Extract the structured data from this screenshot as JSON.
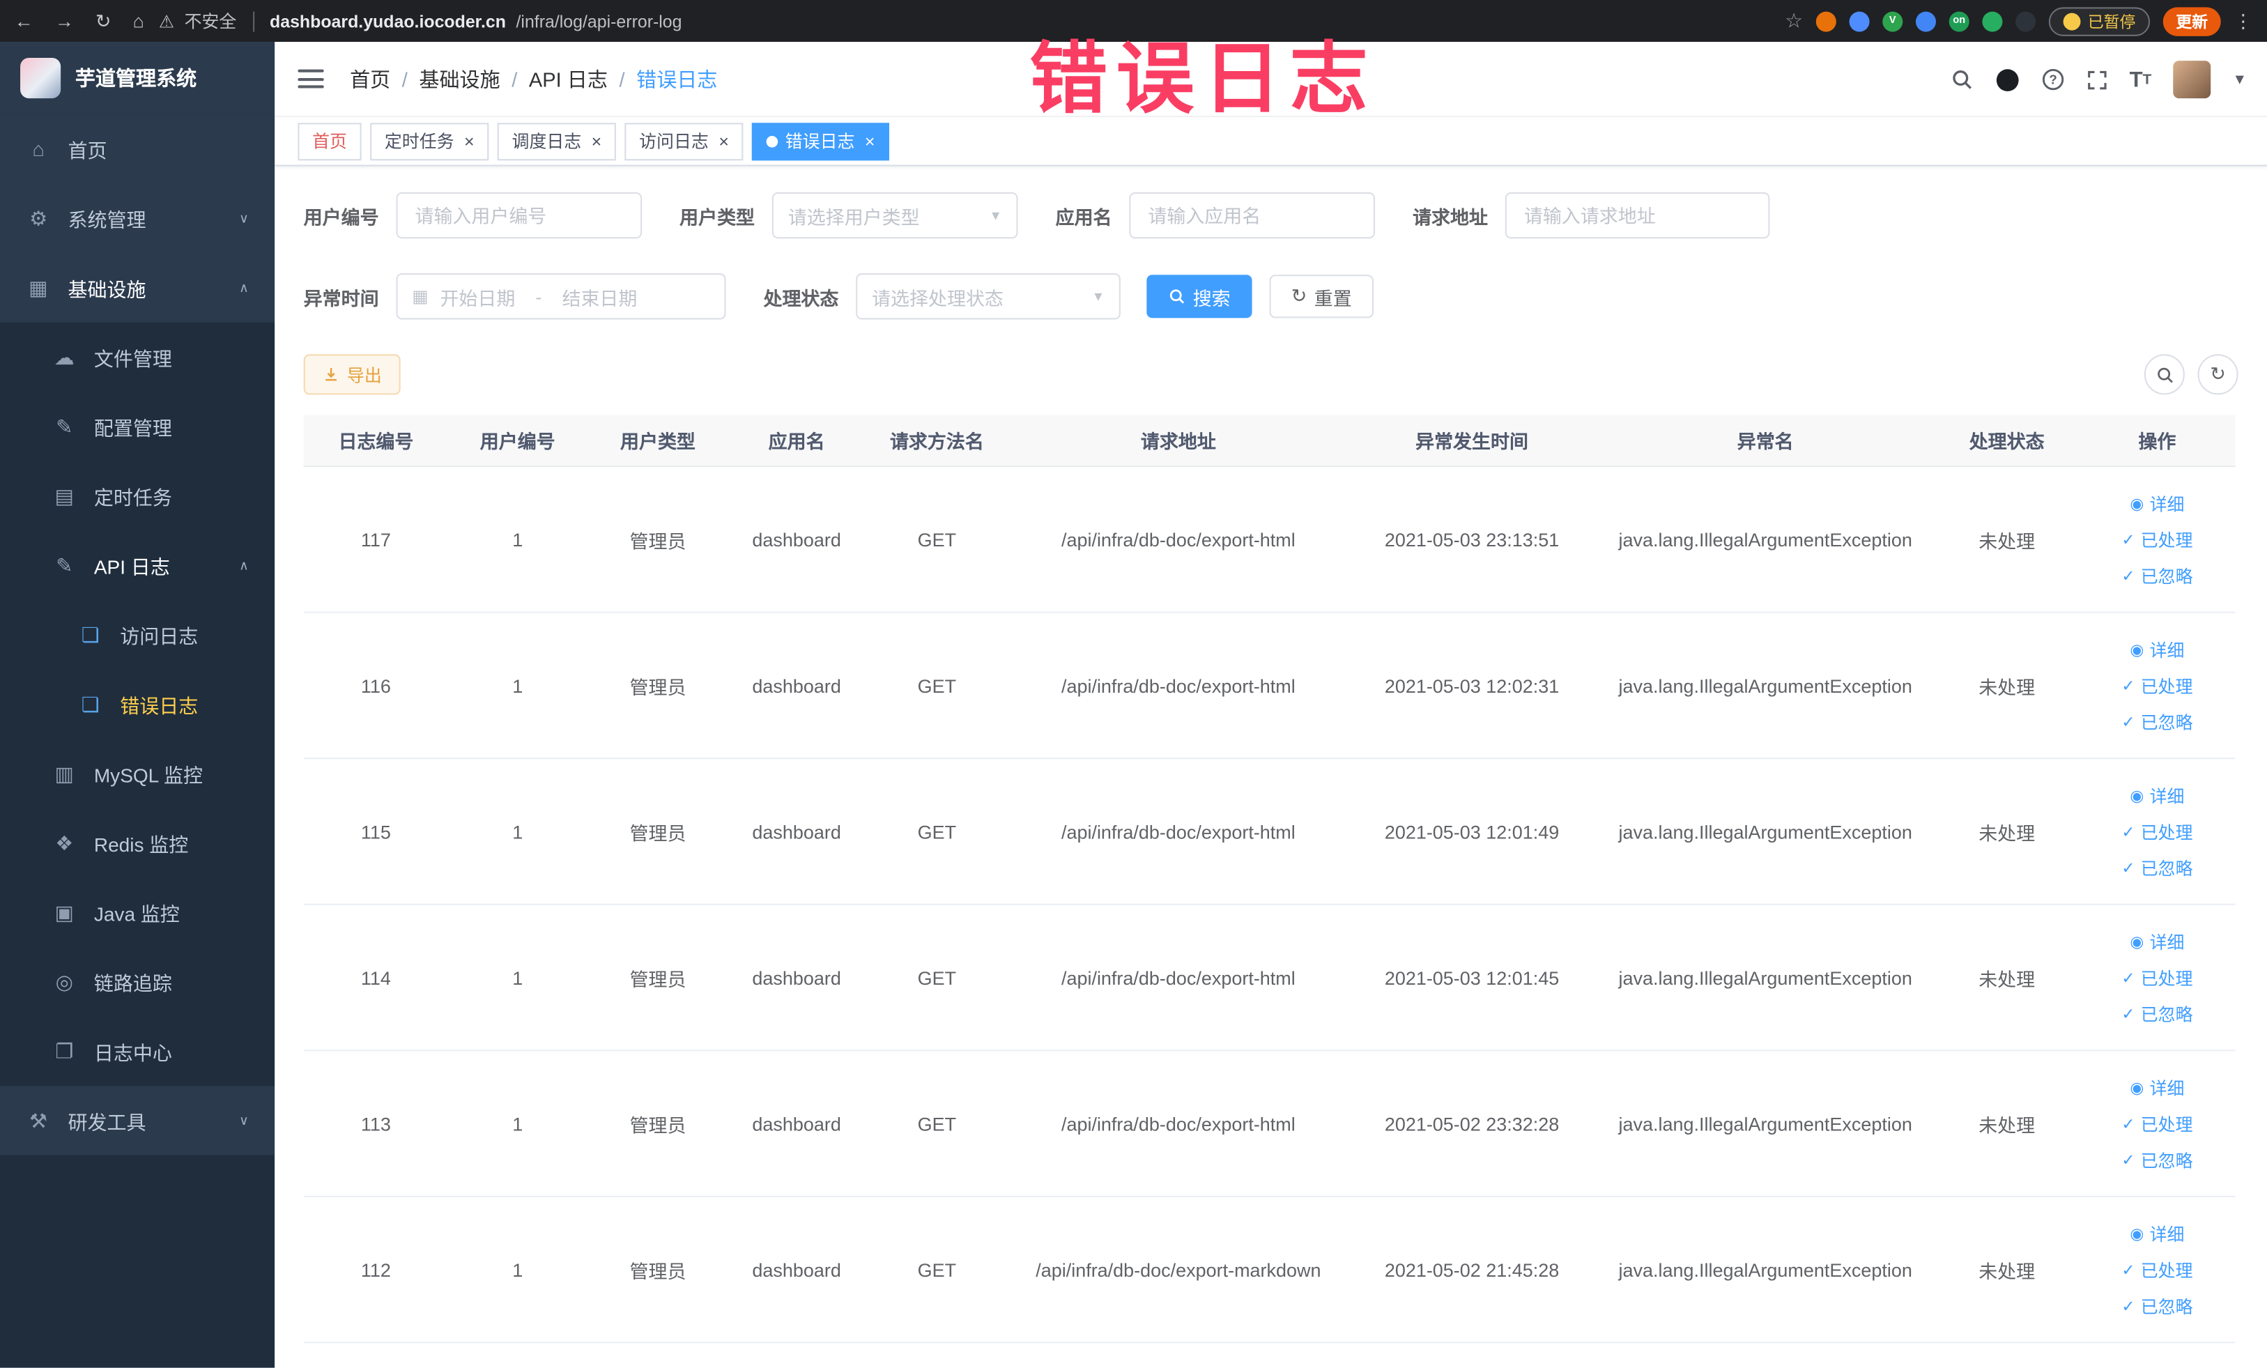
{
  "annotation": {
    "text": "错误日志",
    "color": "#fa3e63"
  },
  "browser": {
    "security_label": "不安全",
    "url_domain": "dashboard.yudao.iocoder.cn",
    "url_path": "/infra/log/api-error-log",
    "paused_badge": "已暂停",
    "update_label": "更新",
    "extensions": [
      {
        "name": "extension-adblock-icon",
        "color": "#e8710a"
      },
      {
        "name": "extension-drop-icon",
        "color": "#4e8cff"
      },
      {
        "name": "extension-vue-devtools-icon",
        "color": "#2ea44f",
        "glyph": "V"
      },
      {
        "name": "extension-grid-icon",
        "color": "#4285f4"
      },
      {
        "name": "extension-switch-on-icon",
        "color": "#1f9d55",
        "glyph": "on"
      },
      {
        "name": "extension-leaf-icon",
        "color": "#27ae60"
      },
      {
        "name": "extension-pawn-icon",
        "color": "#2d333b"
      }
    ]
  },
  "sidebar": {
    "logo_title": "芋道管理系统",
    "items": [
      {
        "id": "home",
        "label": "首页",
        "icon": "home-icon",
        "glyph": "⌂",
        "level": 1
      },
      {
        "id": "system-management",
        "label": "系统管理",
        "icon": "gear-icon",
        "glyph": "⚙",
        "level": 1,
        "chevron": "down"
      },
      {
        "id": "infrastructure",
        "label": "基础设施",
        "icon": "grid-icon",
        "glyph": "▦",
        "level": 1,
        "chevron": "up"
      },
      {
        "id": "file-management",
        "label": "文件管理",
        "icon": "cloud-icon",
        "glyph": "☁",
        "level": 2
      },
      {
        "id": "config-management",
        "label": "配置管理",
        "icon": "edit-icon",
        "glyph": "✎",
        "level": 2
      },
      {
        "id": "scheduled-tasks",
        "label": "定时任务",
        "icon": "schedule-icon",
        "glyph": "▤",
        "level": 2
      },
      {
        "id": "api-logs",
        "label": "API 日志",
        "icon": "log-edit-icon",
        "glyph": "✎",
        "level": 2,
        "chevron": "up"
      },
      {
        "id": "access-log",
        "label": "访问日志",
        "icon": "document-icon",
        "glyph": "❏",
        "level": 3
      },
      {
        "id": "error-log",
        "label": "错误日志",
        "icon": "document-icon",
        "glyph": "❏",
        "level": 3,
        "active": true
      },
      {
        "id": "mysql-monitor",
        "label": "MySQL 监控",
        "icon": "database-icon",
        "glyph": "▥",
        "level": 2
      },
      {
        "id": "redis-monitor",
        "label": "Redis 监控",
        "icon": "layers-icon",
        "glyph": "❖",
        "level": 2
      },
      {
        "id": "java-monitor",
        "label": "Java 监控",
        "icon": "monitor-icon",
        "glyph": "▣",
        "level": 2
      },
      {
        "id": "tracing",
        "label": "链路追踪",
        "icon": "eye-icon",
        "glyph": "◎",
        "level": 2
      },
      {
        "id": "log-center",
        "label": "日志中心",
        "icon": "logs-icon",
        "glyph": "❐",
        "level": 2
      },
      {
        "id": "dev-tools",
        "label": "研发工具",
        "icon": "tools-icon",
        "glyph": "⚒",
        "level": 1,
        "chevron": "down"
      }
    ]
  },
  "header": {
    "breadcrumb": [
      "首页",
      "基础设施",
      "API 日志",
      "错误日志"
    ]
  },
  "tabs": [
    {
      "id": "home",
      "label": "首页",
      "closable": false,
      "text_color": "#e05c5c"
    },
    {
      "id": "scheduled-tasks",
      "label": "定时任务",
      "closable": true
    },
    {
      "id": "schedule-log",
      "label": "调度日志",
      "closable": true
    },
    {
      "id": "access-log",
      "label": "访问日志",
      "closable": true
    },
    {
      "id": "error-log",
      "label": "错误日志",
      "closable": true,
      "active": true
    }
  ],
  "filters": {
    "user_id": {
      "label": "用户编号",
      "placeholder": "请输入用户编号"
    },
    "user_type": {
      "label": "用户类型",
      "placeholder": "请选择用户类型"
    },
    "app_name": {
      "label": "应用名",
      "placeholder": "请输入应用名"
    },
    "request_url": {
      "label": "请求地址",
      "placeholder": "请输入请求地址"
    },
    "exception_time": {
      "label": "异常时间",
      "start_placeholder": "开始日期",
      "separator": "-",
      "end_placeholder": "结束日期"
    },
    "process_status": {
      "label": "处理状态",
      "placeholder": "请选择处理状态"
    },
    "search_label": "搜索",
    "reset_label": "重置"
  },
  "toolbar": {
    "export_label": "导出"
  },
  "table": {
    "columns": [
      "日志编号",
      "用户编号",
      "用户类型",
      "应用名",
      "请求方法名",
      "请求地址",
      "异常发生时间",
      "异常名",
      "处理状态",
      "操作"
    ],
    "actions": [
      {
        "id": "detail",
        "label": "详细",
        "icon": "eye-icon",
        "glyph": "◉"
      },
      {
        "id": "processed",
        "label": "已处理",
        "icon": "check-icon",
        "glyph": "✓"
      },
      {
        "id": "ignored",
        "label": "已忽略",
        "icon": "check-icon",
        "glyph": "✓"
      }
    ],
    "rows": [
      {
        "log_id": "117",
        "user_id": "1",
        "user_type": "管理员",
        "app_name": "dashboard",
        "method": "GET",
        "request_url": "/api/infra/db-doc/export-html",
        "exception_time": "2021-05-03 23:13:51",
        "exception_name": "java.lang.IllegalArgumentException",
        "status": "未处理"
      },
      {
        "log_id": "116",
        "user_id": "1",
        "user_type": "管理员",
        "app_name": "dashboard",
        "method": "GET",
        "request_url": "/api/infra/db-doc/export-html",
        "exception_time": "2021-05-03 12:02:31",
        "exception_name": "java.lang.IllegalArgumentException",
        "status": "未处理"
      },
      {
        "log_id": "115",
        "user_id": "1",
        "user_type": "管理员",
        "app_name": "dashboard",
        "method": "GET",
        "request_url": "/api/infra/db-doc/export-html",
        "exception_time": "2021-05-03 12:01:49",
        "exception_name": "java.lang.IllegalArgumentException",
        "status": "未处理"
      },
      {
        "log_id": "114",
        "user_id": "1",
        "user_type": "管理员",
        "app_name": "dashboard",
        "method": "GET",
        "request_url": "/api/infra/db-doc/export-html",
        "exception_time": "2021-05-03 12:01:45",
        "exception_name": "java.lang.IllegalArgumentException",
        "status": "未处理"
      },
      {
        "log_id": "113",
        "user_id": "1",
        "user_type": "管理员",
        "app_name": "dashboard",
        "method": "GET",
        "request_url": "/api/infra/db-doc/export-html",
        "exception_time": "2021-05-02 23:32:28",
        "exception_name": "java.lang.IllegalArgumentException",
        "status": "未处理"
      },
      {
        "log_id": "112",
        "user_id": "1",
        "user_type": "管理员",
        "app_name": "dashboard",
        "method": "GET",
        "request_url": "/api/infra/db-doc/export-markdown",
        "exception_time": "2021-05-02 21:45:28",
        "exception_name": "java.lang.IllegalArgumentException",
        "status": "未处理"
      }
    ]
  }
}
